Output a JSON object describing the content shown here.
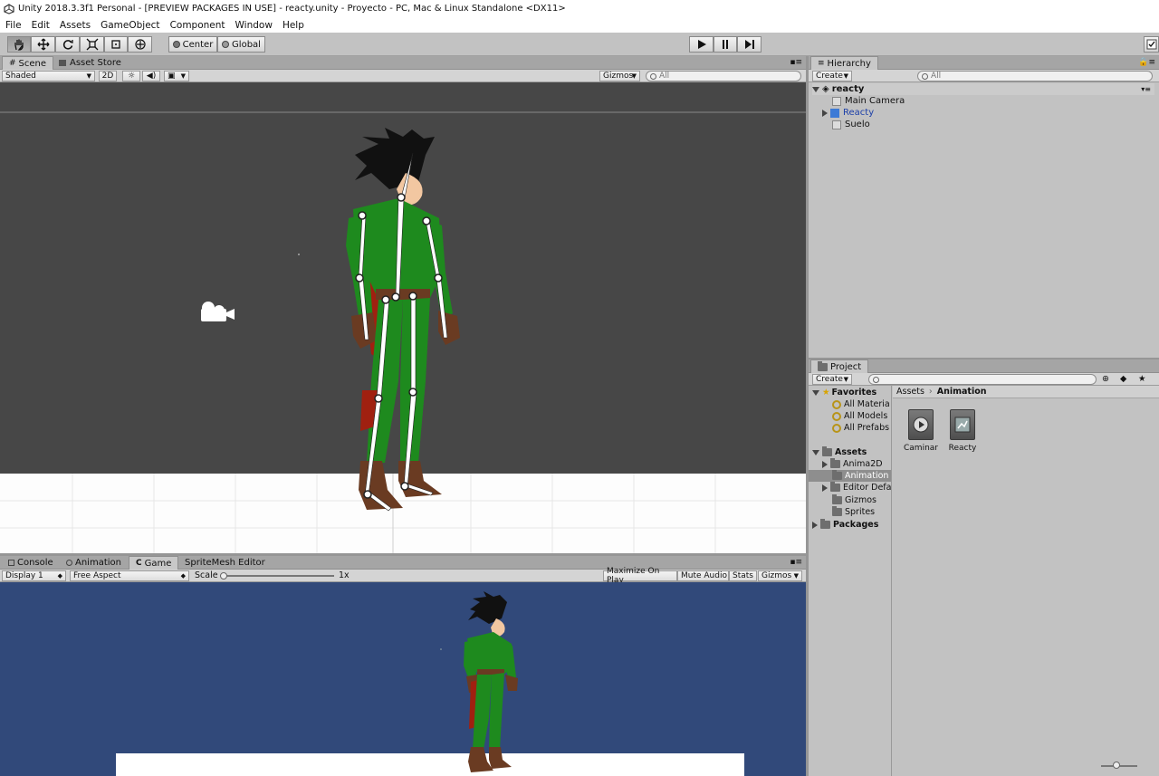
{
  "window": {
    "title": "Unity 2018.3.3f1 Personal - [PREVIEW PACKAGES IN USE] - reacty.unity - Proyecto - PC, Mac & Linux Standalone <DX11>"
  },
  "menu": [
    "File",
    "Edit",
    "Assets",
    "GameObject",
    "Component",
    "Window",
    "Help"
  ],
  "toolbar": {
    "tools": [
      "hand-icon",
      "move-icon",
      "rotate-icon",
      "scale-icon",
      "rect-tool-icon",
      "transform-tool-icon"
    ],
    "pivot": "Center",
    "space": "Global"
  },
  "scene": {
    "tabs": [
      "Scene",
      "Asset Store"
    ],
    "shading": "Shaded",
    "mode_2d": "2D",
    "gizmos": "Gizmos",
    "search_placeholder": "All"
  },
  "bottom": {
    "tabs": [
      "Console",
      "Animation",
      "Game",
      "SpriteMesh Editor"
    ],
    "display": "Display 1",
    "aspect": "Free Aspect",
    "scale_label": "Scale",
    "scale_value": "1x",
    "scale_fraction": 0.0,
    "buttons": [
      "Maximize On Play",
      "Mute Audio",
      "Stats",
      "Gizmos"
    ]
  },
  "hierarchy": {
    "tab": "Hierarchy",
    "create": "Create",
    "search_placeholder": "All",
    "scene": "reacty",
    "items": [
      "Main Camera",
      "Reacty",
      "Suelo"
    ]
  },
  "project": {
    "tab": "Project",
    "create": "Create",
    "favorites_label": "Favorites",
    "favorites": [
      "All Materia",
      "All Models",
      "All Prefabs"
    ],
    "assets_label": "Assets",
    "folders": [
      "Anima2D",
      "Animation",
      "Editor Defa",
      "Gizmos",
      "Sprites"
    ],
    "packages_label": "Packages",
    "breadcrumb": [
      "Assets",
      "Animation"
    ],
    "items": [
      "Caminar",
      "Reacty"
    ]
  },
  "colors": {
    "scene_bg": "#474747",
    "game_bg": "#31497a",
    "selected_item": "#3c6fd6",
    "panel_bg": "#c2c2c2"
  }
}
